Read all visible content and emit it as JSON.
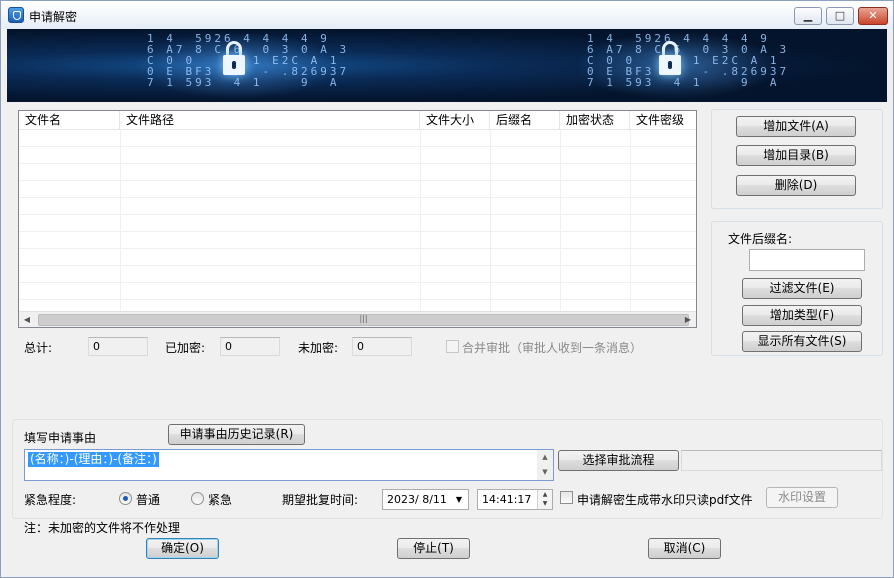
{
  "window": {
    "title": "申请解密",
    "minimize": "▁",
    "maximize": "□",
    "close": "✕"
  },
  "banner": {
    "digits_left": "1 4  5926 4 4 4 4 9\n6 A7 8 C 6  0 3 0 A 3\nC 0 0   C0 1 E2C A 1\n0 E BF3 7   - .826937\n7 1 593  4 1    9  A",
    "digits_right": "1 4  5926 4 4 4 4 9\n6 A7 8 C 6  0 3 0 A 3\nC 0 0   C0 1 E2C A 1\n0 E BF3 7   - .826937\n7 1 593  4 1    9  A"
  },
  "file_list": {
    "columns": [
      "文件名",
      "文件路径",
      "文件大小",
      "后缀名",
      "加密状态",
      "文件密级"
    ],
    "rows": []
  },
  "actions": {
    "add_file": "增加文件(A)",
    "add_dir": "增加目录(B)",
    "delete": "删除(D)"
  },
  "filter": {
    "suffix_label": "文件后缀名:",
    "suffix_value": "",
    "filter_files": "过滤文件(E)",
    "add_type": "增加类型(F)",
    "show_all": "显示所有文件(S)"
  },
  "stats": {
    "total_label": "总计:",
    "total_value": "0",
    "encrypted_label": "已加密:",
    "encrypted_value": "0",
    "unencrypted_label": "未加密:",
    "unencrypted_value": "0",
    "merge_label": "合并审批（审批人收到一条消息）"
  },
  "reason": {
    "label": "填写申请事由",
    "history_button": "申请事由历史记录(R)",
    "value": "(名称：)-(理由：)-(备注：)",
    "select_flow": "选择审批流程"
  },
  "urgency": {
    "label": "紧急程度:",
    "normal": "普通",
    "urgent": "紧急",
    "selected": "普通"
  },
  "approval_time": {
    "label": "期望批复时间:",
    "date": "2023/  8/11",
    "time": "14:41:17"
  },
  "watermark": {
    "checkbox_label": "申请解密生成带水印只读pdf文件",
    "settings_button": "水印设置"
  },
  "note": "注：未加密的文件将不作处理",
  "footer": {
    "ok": "确定(O)",
    "stop": "停止(T)",
    "cancel": "取消(C)"
  }
}
